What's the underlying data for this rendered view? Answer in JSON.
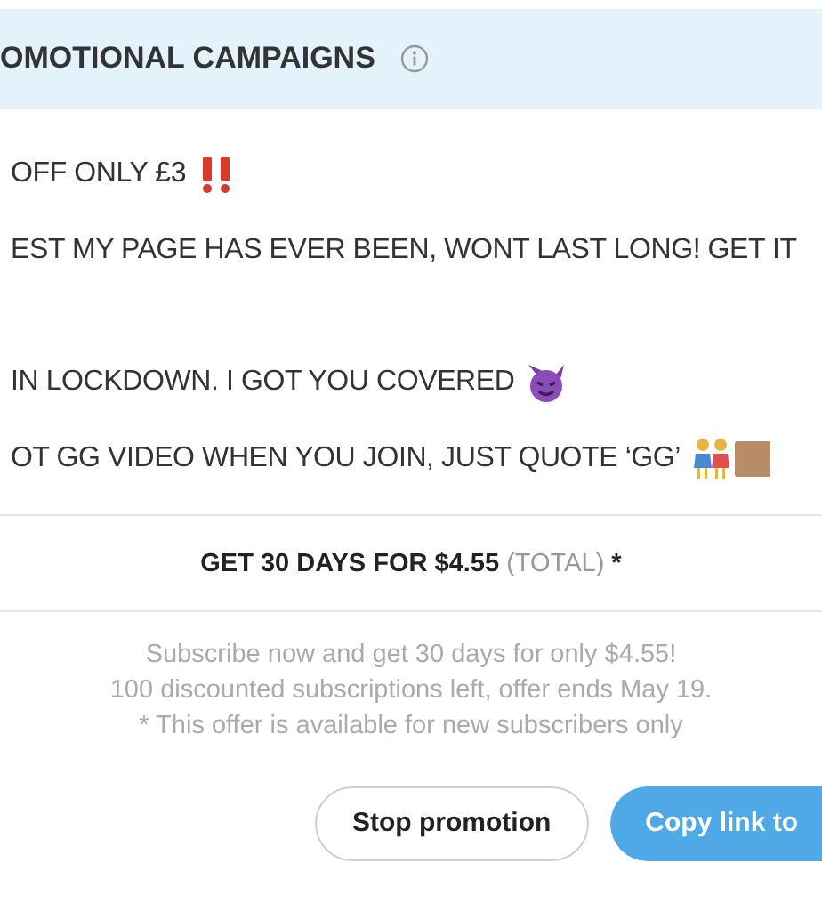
{
  "header": {
    "title": "OMOTIONAL CAMPAIGNS"
  },
  "message_lines": [
    {
      "text": "OFF ONLY £3",
      "kind": "exclaim"
    },
    {
      "text": "EST MY PAGE HAS EVER BEEN, WONT LAST LONG! GET IT"
    },
    {
      "text": "IN LOCKDOWN. I GOT YOU COVERED",
      "kind": "devil"
    },
    {
      "text": "OT GG VIDEO WHEN YOU JOIN, JUST QUOTE ‘GG’",
      "kind": "figures"
    }
  ],
  "offer": {
    "headline": "GET 30 DAYS FOR $4.55",
    "headline_note": "(TOTAL)",
    "headline_mark": "*"
  },
  "notes": [
    "Subscribe now and get 30 days for only $4.55!",
    "100 discounted subscriptions left, offer ends May 19.",
    "* This offer is available for new subscribers only"
  ],
  "buttons": [
    {
      "label": "Stop promotion",
      "kind": "outline"
    },
    {
      "label": "Copy link to",
      "kind": "primary"
    }
  ]
}
